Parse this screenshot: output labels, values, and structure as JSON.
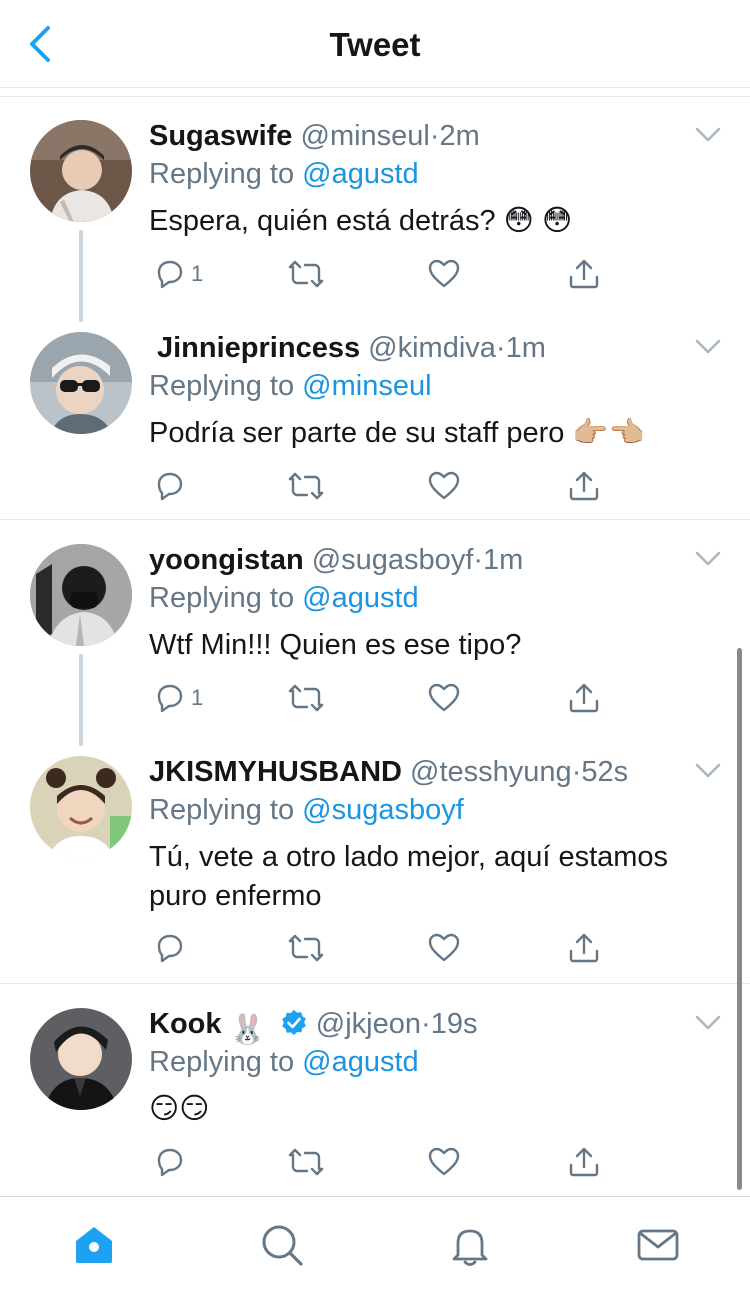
{
  "header": {
    "title": "Tweet",
    "back_icon": "chevron-left-icon"
  },
  "colors": {
    "accent": "#1da1f2",
    "link": "#1b95e0",
    "muted": "#657786",
    "text": "#14171a",
    "divider": "#e1e8ed"
  },
  "tweets": [
    {
      "name": "Sugaswife",
      "handle": "@minseul",
      "time": "2m",
      "reply_prefix": "Replying to",
      "reply_to": "@agustd",
      "text": "Espera, quién está detrás? 😳 😳",
      "reply_count": "1"
    },
    {
      "name": "Jinnieprincess",
      "handle": "@kimdiva",
      "time": "1m",
      "reply_prefix": "Replying to",
      "reply_to": "@minseul",
      "text": "Podría ser parte de su staff pero 👉🏼👈🏼",
      "reply_count": ""
    },
    {
      "name": "yoongistan",
      "handle": "@sugasboyf",
      "time": "1m",
      "reply_prefix": "Replying to",
      "reply_to": "@agustd",
      "text": "Wtf Min!!! Quien es ese tipo?",
      "reply_count": "1"
    },
    {
      "name": "JKISMYHUSBAND",
      "handle": "@tesshyung",
      "time": "52s",
      "reply_prefix": "Replying to",
      "reply_to": "@sugasboyf",
      "text": "Tú, vete a otro lado mejor, aquí estamos puro enfermo",
      "reply_count": ""
    },
    {
      "name": "Kook",
      "name_emoji": "🐰",
      "verified": true,
      "handle": "@jkjeon",
      "time": "19s",
      "reply_prefix": "Replying to",
      "reply_to": "@agustd",
      "text": "😏😏",
      "reply_count": ""
    }
  ],
  "dot": "·",
  "tabbar": {
    "tabs": [
      "home-icon",
      "search-icon",
      "notifications-icon",
      "messages-icon"
    ],
    "active": "home-icon"
  }
}
